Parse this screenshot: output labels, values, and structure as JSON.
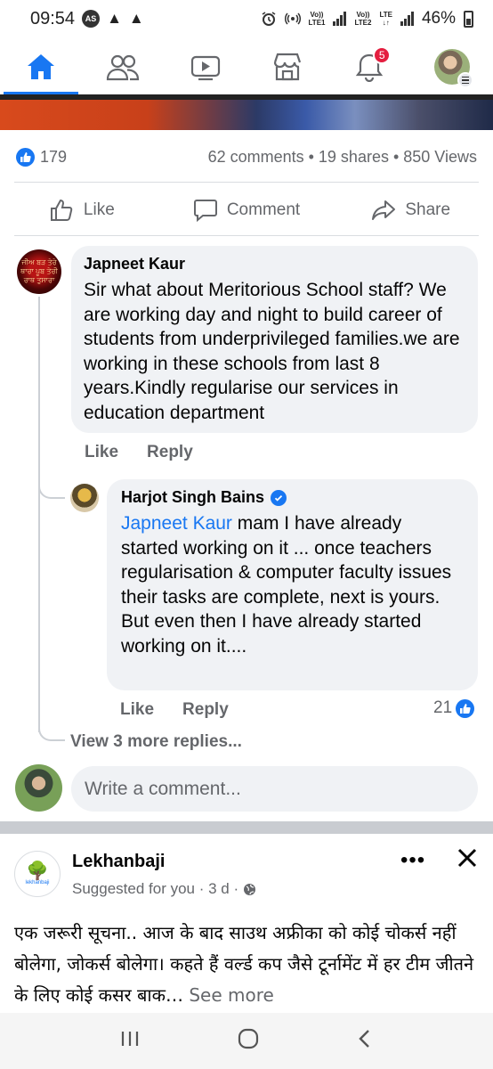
{
  "status_bar": {
    "time": "09:54",
    "as_badge": "AS",
    "net1_top": "Vo))",
    "net1_bottom": "LTE1",
    "net2_top": "Vo))",
    "net2_bottom": "LTE2",
    "lte": "LTE",
    "battery": "46%"
  },
  "nav": {
    "items": [
      "home-icon",
      "friends-icon",
      "video-icon",
      "marketplace-icon",
      "notifications-icon",
      "profile-avatar"
    ],
    "active": "home",
    "notification_count": "5"
  },
  "post": {
    "like_count": "179",
    "stats": "62 comments • 19 shares • 850 Views",
    "actions": {
      "like": "Like",
      "comment": "Comment",
      "share": "Share"
    }
  },
  "comments": [
    {
      "author": "Japneet Kaur",
      "avatar_text": "ਜੀਅ ਬੜ ਤੇਰੇ ਥਾਰਾ ਪੂਬ ਤੇਰੀ ਰਾਥ ਤੁਸਾਰਾ",
      "text": "Sir what about Meritorious School staff? We are working day and night to build career of students from underprivileged families.we are working in these schools from last 8 years.Kindly regularise our services in education department",
      "like_label": "Like",
      "reply_label": "Reply"
    },
    {
      "author": "Harjot Singh Bains",
      "verified": true,
      "mention": "Japneet Kaur",
      "text": " mam I have already started working on it ... once teachers regularisation & computer faculty issues their tasks are complete, next is yours. But even then I have already started working on it....",
      "like_label": "Like",
      "reply_label": "Reply",
      "reaction_count": "21"
    }
  ],
  "view_more": "View 3 more replies...",
  "write_placeholder": "Write a comment...",
  "suggested": {
    "page_name": "Lekhanbaji",
    "logo_text": "lekhanbaji",
    "subtitle": "Suggested for you · 3 d ·",
    "more_label": "•••",
    "text": "एक जरूरी सूचना.. आज के बाद साउथ अफ्रीका को कोई चोकर्स नहीं बोलेगा, जोकर्स बोलेगा। कहते हैं वर्ल्ड कप जैसे टूर्नामेंट में हर टीम जीतने के लिए कोई कसर बाक…",
    "see_more": "See more"
  },
  "android_nav": [
    "recents-icon",
    "home-circle-icon",
    "back-icon"
  ],
  "colors": {
    "accent": "#1877f2",
    "badge": "#e41e3f",
    "muted": "#65676b",
    "bubble": "#f0f2f5"
  }
}
